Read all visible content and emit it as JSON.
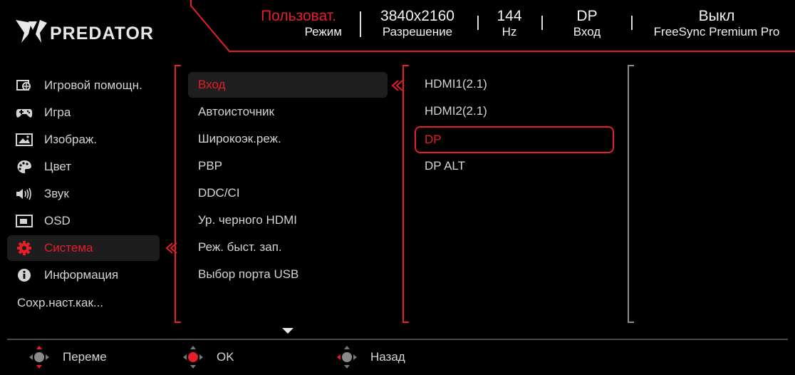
{
  "header": {
    "logo_text": "PREDATOR",
    "mode": {
      "value": "Пользоват.",
      "label": "Режим"
    },
    "resolution": {
      "value": "3840x2160",
      "label": "Разрешение"
    },
    "refresh": {
      "value": "144",
      "label": "Hz"
    },
    "input": {
      "value": "DP",
      "label": "Вход"
    },
    "freesync": {
      "value": "Выкл",
      "label": "FreeSync Premium Pro"
    }
  },
  "sidebar": {
    "items": [
      {
        "label": "Игровой помощн.",
        "icon": "gaming-assistant-icon"
      },
      {
        "label": "Игра",
        "icon": "gamepad-icon"
      },
      {
        "label": "Изображ.",
        "icon": "picture-icon"
      },
      {
        "label": "Цвет",
        "icon": "palette-icon"
      },
      {
        "label": "Звук",
        "icon": "speaker-icon"
      },
      {
        "label": "OSD",
        "icon": "osd-icon"
      },
      {
        "label": "Система",
        "icon": "gear-icon",
        "active": true
      },
      {
        "label": "Информация",
        "icon": "info-icon"
      }
    ],
    "save_label": "Сохр.наст.как..."
  },
  "submenu": {
    "items": [
      "Вход",
      "Автоисточник",
      "Широкоэк.реж.",
      "PBP",
      "DDC/CI",
      "Ур. черного HDMI",
      "Реж. быст. зап.",
      "Выбор порта USB"
    ],
    "active_index": 0
  },
  "options": {
    "items": [
      "HDMI1(2.1)",
      "HDMI2(2.1)",
      "DP",
      "DP ALT"
    ],
    "selected_index": 2
  },
  "footer": {
    "move_label": "Переме",
    "ok_label": "OK",
    "back_label": "Назад"
  },
  "colors": {
    "accent": "#e41e2a",
    "background": "#000000",
    "text": "#d4d4d4"
  }
}
